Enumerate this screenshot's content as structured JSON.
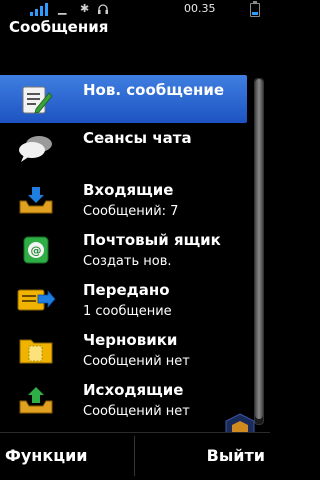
{
  "status": {
    "time": "00.35",
    "signal_bars": 4
  },
  "title": "Сообщения",
  "menu": {
    "items": [
      {
        "label": "Нов. сообщение",
        "sub": "",
        "icon": "new-message-icon",
        "selected": true
      },
      {
        "label": "Сеансы чата",
        "sub": "",
        "icon": "chat-bubbles-icon",
        "selected": false
      },
      {
        "label": "Входящие",
        "sub": "Сообщений: 7",
        "icon": "inbox-tray-icon",
        "selected": false
      },
      {
        "label": "Почтовый ящик",
        "sub": "Создать нов.",
        "icon": "mailbox-icon",
        "selected": false
      },
      {
        "label": "Передано",
        "sub": "1 сообщение",
        "icon": "sent-icon",
        "selected": false
      },
      {
        "label": "Черновики",
        "sub": "Сообщений нет",
        "icon": "drafts-folder-icon",
        "selected": false
      },
      {
        "label": "Исходящие",
        "sub": "Сообщений нет",
        "icon": "outbox-tray-icon",
        "selected": false
      }
    ]
  },
  "softkeys": {
    "left": "Функции",
    "right": "Выйти"
  },
  "colors": {
    "selection": "#2a66d4",
    "accent": "#2f9bff"
  }
}
